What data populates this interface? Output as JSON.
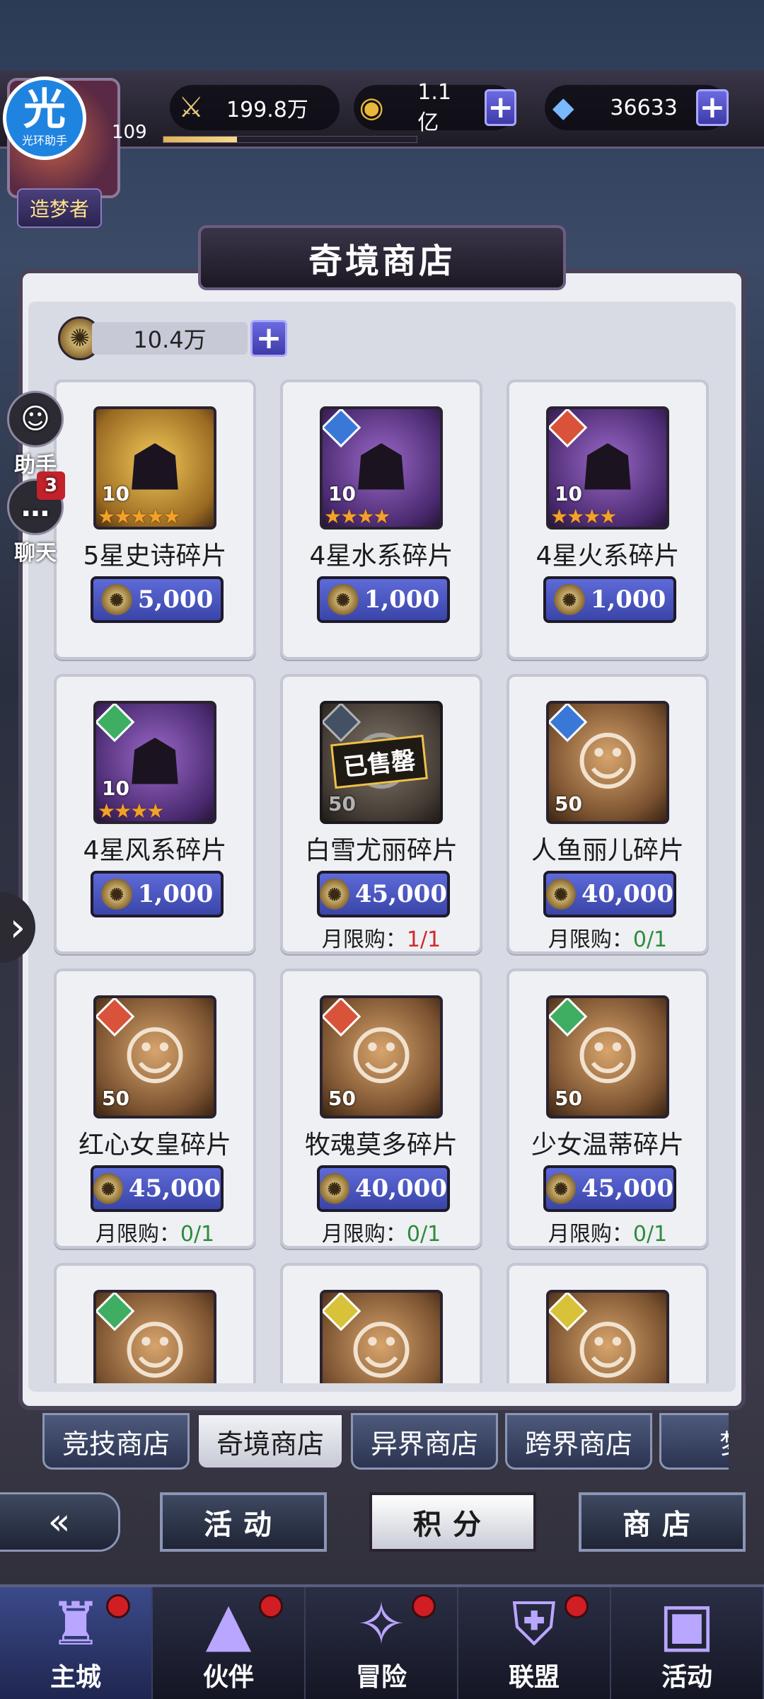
{
  "resources": {
    "power": "199.8万",
    "gold": "1.1亿",
    "diamond": "36633",
    "plus": "+"
  },
  "player": {
    "level": "109",
    "xp_progress": 0.29,
    "title": "造梦者",
    "helper_badge_big": "光",
    "helper_badge_small": "光环助手"
  },
  "side": {
    "assistant_label": "助手",
    "chat_label": "聊天",
    "chat_badge": "3",
    "arrow": "›"
  },
  "shop": {
    "title": "奇境商店",
    "currency": "10.4万"
  },
  "items": [
    {
      "name": "5星史诗碎片",
      "price": "5,000",
      "count": "10",
      "stars": "★★★★★"
    },
    {
      "name": "4星水系碎片",
      "price": "1,000",
      "count": "10",
      "stars": "★★★★"
    },
    {
      "name": "4星火系碎片",
      "price": "1,000",
      "count": "10",
      "stars": "★★★★"
    },
    {
      "name": "4星风系碎片",
      "price": "1,000",
      "count": "10",
      "stars": "★★★★"
    },
    {
      "name": "白雪尤丽碎片",
      "price": "45,000",
      "count": "50",
      "limit_label": "月限购：",
      "limit_value": "1/1",
      "sold": "已售罄"
    },
    {
      "name": "人鱼丽儿碎片",
      "price": "40,000",
      "count": "50",
      "limit_label": "月限购：",
      "limit_value": "0/1"
    },
    {
      "name": "红心女皇碎片",
      "price": "45,000",
      "count": "50",
      "limit_label": "月限购：",
      "limit_value": "0/1"
    },
    {
      "name": "牧魂莫多碎片",
      "price": "40,000",
      "count": "50",
      "limit_label": "月限购：",
      "limit_value": "0/1"
    },
    {
      "name": "少女温蒂碎片",
      "price": "45,000",
      "count": "50",
      "limit_label": "月限购：",
      "limit_value": "0/1"
    }
  ],
  "tabs": [
    "竞技商店",
    "奇境商店",
    "异界商店",
    "跨界商店",
    "梦"
  ],
  "modes": [
    "活动",
    "积分",
    "商店"
  ],
  "back_icon": "«",
  "nav": [
    "主城",
    "伙伴",
    "冒险",
    "联盟",
    "活动"
  ],
  "colors": {
    "accent": "#5e6ad8",
    "limit_used": "#d12a2a",
    "limit_free": "#2e8b3a"
  }
}
